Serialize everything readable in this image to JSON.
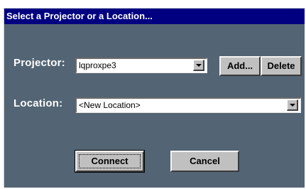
{
  "dialog": {
    "title": "Select a Projector or a Location...",
    "projector": {
      "label": "Projector:",
      "value": "lqproxpe3",
      "add_label": "Add...",
      "delete_label": "Delete"
    },
    "location": {
      "label": "Location:",
      "value": "<New Location>"
    },
    "connect_label": "Connect",
    "cancel_label": "Cancel"
  },
  "colors": {
    "titlebar": "#000080",
    "dialog_bg": "#536474",
    "button_face": "#c0c0c0"
  }
}
